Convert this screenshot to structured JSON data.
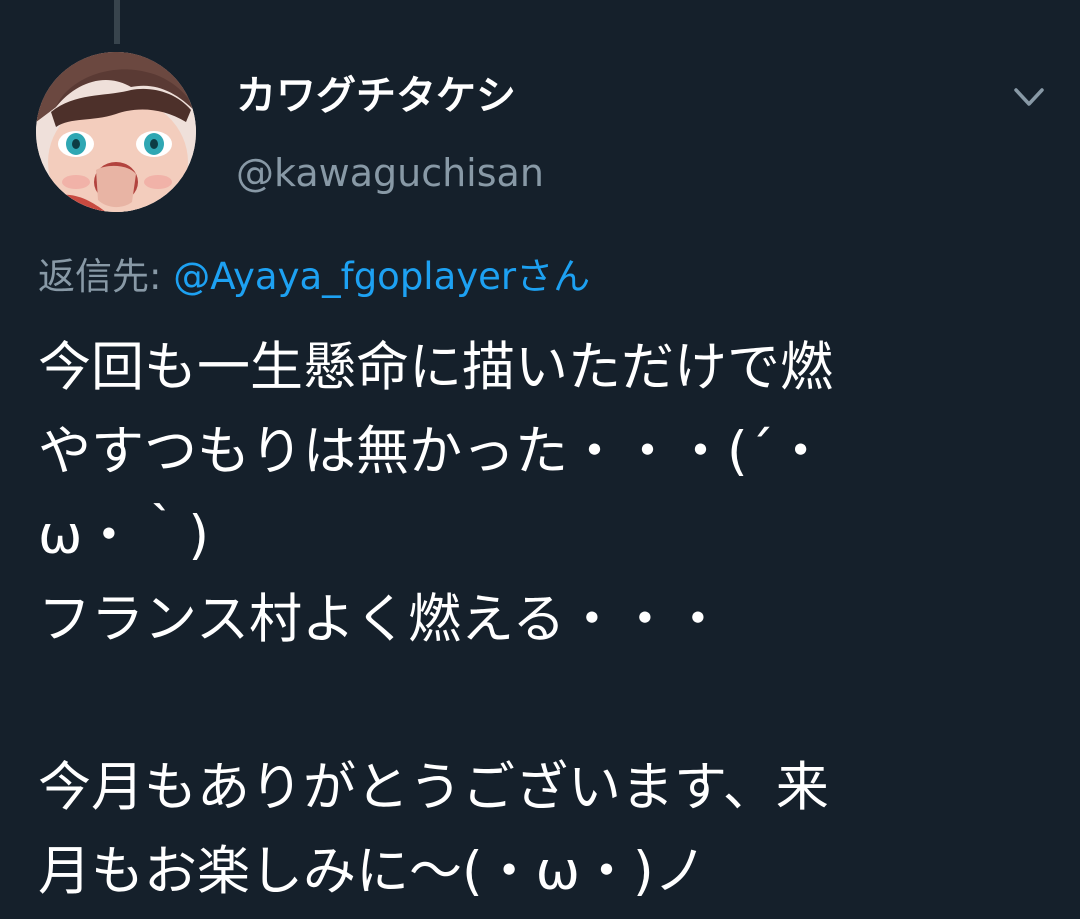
{
  "tweet": {
    "user": {
      "display_name": "カワグチタケシ",
      "handle": "@kawaguchisan"
    },
    "reply": {
      "prefix": "返信先: ",
      "to": "@Ayaya_fgoplayer",
      "suffix": "さん"
    },
    "lines": [
      "今回も一生懸命に描いただけで燃",
      "やすつもりは無かった・・・(´・",
      "ω・｀)",
      "フランス村よく燃える・・・",
      "",
      "今月もありがとうございます、来",
      "月もお楽しみに〜(・ω・)ノ"
    ],
    "icons": {
      "menu": "chevron-down-icon",
      "avatar": "avatar-image"
    },
    "colors": {
      "background": "#15202b",
      "text": "#ffffff",
      "secondary": "#8899a6",
      "link": "#1da1f2"
    }
  }
}
